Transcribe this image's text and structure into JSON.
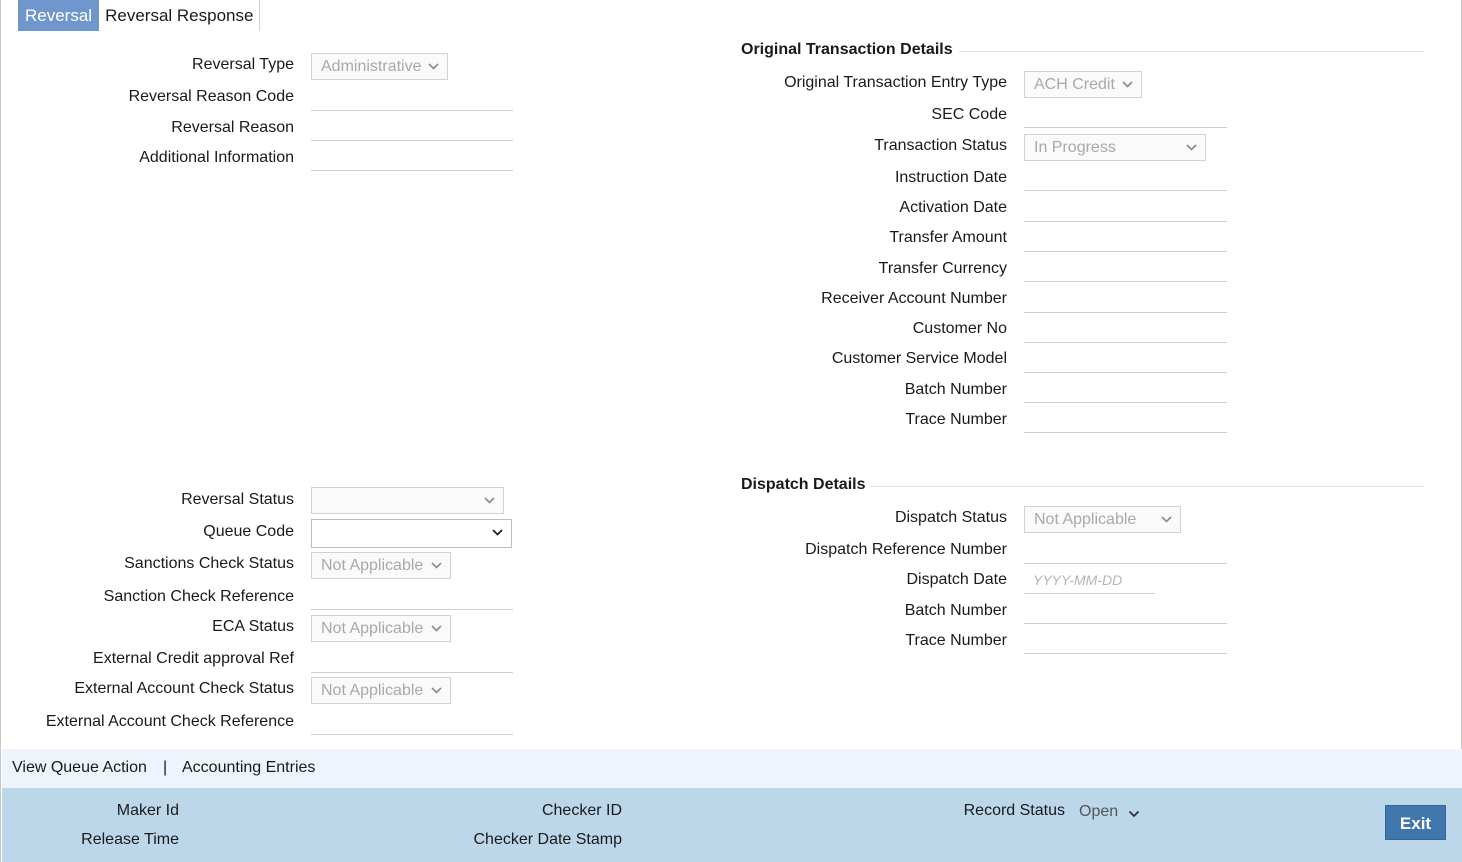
{
  "tabs": [
    {
      "label": "Reversal",
      "active": true
    },
    {
      "label": "Reversal Response",
      "active": false
    }
  ],
  "left_top": {
    "reversal_type": {
      "label": "Reversal Type",
      "value": "Administrative"
    },
    "reversal_reason_code": {
      "label": "Reversal Reason Code",
      "value": ""
    },
    "reversal_reason": {
      "label": "Reversal Reason",
      "value": ""
    },
    "additional_information": {
      "label": "Additional Information",
      "value": ""
    }
  },
  "original": {
    "title": "Original Transaction Details",
    "entry_type": {
      "label": "Original Transaction Entry Type",
      "value": "ACH Credit"
    },
    "sec_code": {
      "label": "SEC Code",
      "value": ""
    },
    "transaction_status": {
      "label": "Transaction Status",
      "value": "In Progress"
    },
    "instruction_date": {
      "label": "Instruction Date",
      "value": ""
    },
    "activation_date": {
      "label": "Activation Date",
      "value": ""
    },
    "transfer_amount": {
      "label": "Transfer Amount",
      "value": ""
    },
    "transfer_currency": {
      "label": "Transfer Currency",
      "value": ""
    },
    "receiver_account_number": {
      "label": "Receiver Account Number",
      "value": ""
    },
    "customer_no": {
      "label": "Customer No",
      "value": ""
    },
    "customer_service_model": {
      "label": "Customer Service Model",
      "value": ""
    },
    "batch_number": {
      "label": "Batch Number",
      "value": ""
    },
    "trace_number": {
      "label": "Trace Number",
      "value": ""
    }
  },
  "left_bottom": {
    "reversal_status": {
      "label": "Reversal Status",
      "value": ""
    },
    "queue_code": {
      "label": "Queue Code",
      "value": ""
    },
    "sanctions_check_status": {
      "label": "Sanctions Check Status",
      "value": "Not Applicable"
    },
    "sanction_check_reference": {
      "label": "Sanction Check Reference",
      "value": ""
    },
    "eca_status": {
      "label": "ECA Status",
      "value": "Not Applicable"
    },
    "external_credit_approval_ref": {
      "label": "External Credit approval Ref",
      "value": ""
    },
    "external_account_check_status": {
      "label": "External Account Check Status",
      "value": "Not Applicable"
    },
    "external_account_check_reference": {
      "label": "External Account Check Reference",
      "value": ""
    }
  },
  "dispatch": {
    "title": "Dispatch Details",
    "dispatch_status": {
      "label": "Dispatch Status",
      "value": "Not Applicable"
    },
    "dispatch_reference_number": {
      "label": "Dispatch Reference Number",
      "value": ""
    },
    "dispatch_date": {
      "label": "Dispatch Date",
      "placeholder": "YYYY-MM-DD"
    },
    "batch_number": {
      "label": "Batch Number",
      "value": ""
    },
    "trace_number": {
      "label": "Trace Number",
      "value": ""
    }
  },
  "links": {
    "view_queue_action": "View Queue Action",
    "separator": "|",
    "accounting_entries": "Accounting Entries"
  },
  "audit": {
    "maker_id": "Maker Id",
    "release_time": "Release Time",
    "checker_id": "Checker ID",
    "checker_date_stamp": "Checker Date Stamp",
    "record_status_label": "Record Status",
    "record_status_value": "Open",
    "exit_label": "Exit"
  },
  "colors": {
    "tab_active": "#6f96cd",
    "links_bar": "#eef4fb",
    "audit_bar": "#bcd6ea",
    "exit_button": "#3f77ad"
  },
  "icons": {
    "dropdown": "chevron-down-icon"
  }
}
